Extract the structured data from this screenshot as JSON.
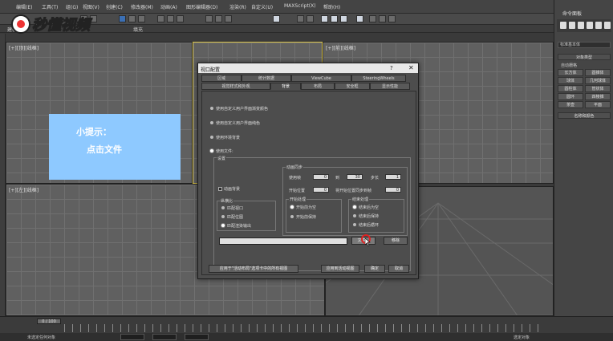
{
  "menubar": {
    "items": [
      "编辑(E)",
      "工具(T)",
      "组(G)",
      "视图(V)",
      "创建(C)",
      "修改器(M)",
      "动画(A)",
      "图形编辑器(D)",
      "渲染(R)",
      "自定义(U)",
      "MAXScript(X)",
      "帮助(H)"
    ]
  },
  "ribbon": {
    "left_label": "建模",
    "fill_label": "填充"
  },
  "watermark": {
    "brand": "秒懂视频"
  },
  "viewports": {
    "top_left_label": "[+][顶][线框]",
    "top_right_label": "[+][前][线框]",
    "bottom_left_label": "[+][左][线框]"
  },
  "command_panel": {
    "title": "命令面板",
    "dropdown": "标准基本体",
    "object_type_header": "对象类型",
    "autogrid_label": "自动栅格",
    "buttons": [
      "长方体",
      "圆锥体",
      "球体",
      "几何球体",
      "圆柱体",
      "管状体",
      "圆环",
      "四棱锥",
      "茶壶",
      "平面"
    ],
    "name_color_header": "名称和颜色"
  },
  "tip": {
    "title": "小提示：",
    "body": "点击文件"
  },
  "dialog": {
    "title": "视口配置",
    "help": "?",
    "close": "✕",
    "tabs_row1": [
      "区域",
      "统计数据",
      "ViewCube",
      "SteeringWheels"
    ],
    "tabs_row2": [
      "视觉样式和外观",
      "背景",
      "布局",
      "安全框",
      "显示性能"
    ],
    "radios": [
      "使用自定义用户界面渐变颜色",
      "使用自定义用户界面纯色",
      "使用环境背景",
      "使用文件:"
    ],
    "settings_label": "设置",
    "anim_bg_label": "动画背景",
    "aspect_group": "纵横比",
    "aspect_options": [
      "匹配视口",
      "匹配位图",
      "匹配渲染输出"
    ],
    "sync_group": "动画同步",
    "use_frame_label": "使用帧",
    "use_frame_from": "0",
    "to_label": "到",
    "use_frame_to": "30",
    "step_label": "步长",
    "step_value": "1",
    "start_pos_label": "开始位置",
    "start_pos_value": "0",
    "sync_start_label": "将开始位置同步到帧",
    "sync_start_value": "0",
    "start_proc_group": "开始处理",
    "start_proc_options": [
      "开始前为空",
      "开始前保持"
    ],
    "end_proc_group": "结束处理",
    "end_proc_options": [
      "结束后为空",
      "结束后保持",
      "结束后循环"
    ],
    "file_button": "文件...",
    "remove_button": "移除",
    "apply_all_button": "应用于\"活动布局\"选项卡中的所有视图",
    "apply_active_button": "应用到活动视图",
    "ok_button": "确定",
    "cancel_button": "取消"
  },
  "timeline": {
    "frame": "0 / 100"
  },
  "status": {
    "text": "未选定任何对象",
    "selection": "选定对象"
  }
}
